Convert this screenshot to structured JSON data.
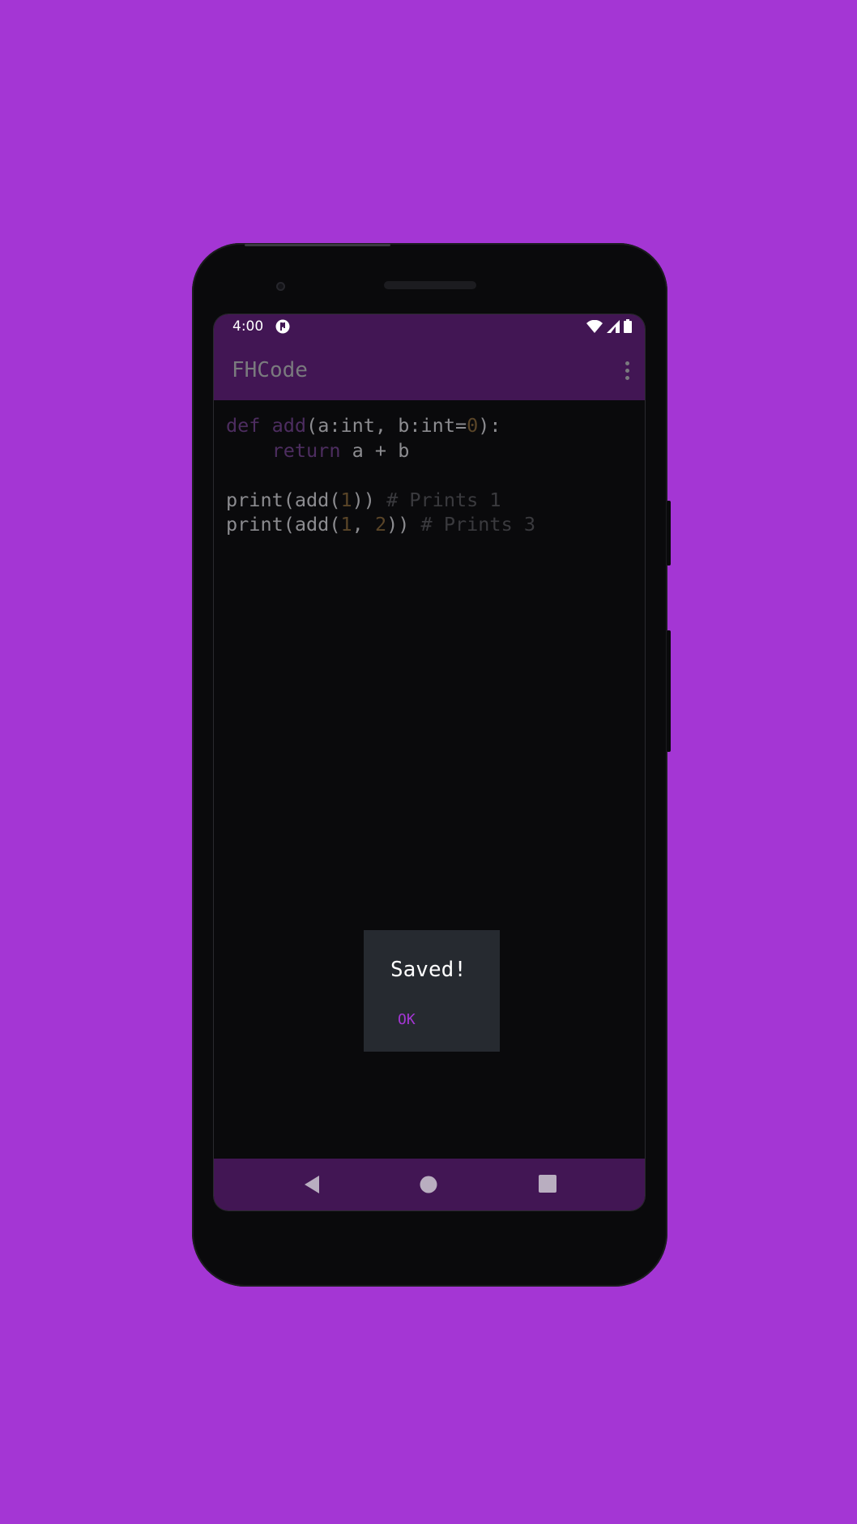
{
  "status_bar": {
    "time": "4:00"
  },
  "app_bar": {
    "title": "FHCode",
    "menu_icon": "more-vert-icon"
  },
  "editor": {
    "lines": [
      [
        {
          "t": "def ",
          "c": "kw"
        },
        {
          "t": "add",
          "c": "fn"
        },
        {
          "t": "(a:int, b:int=",
          "c": "plain"
        },
        {
          "t": "0",
          "c": "num"
        },
        {
          "t": "):",
          "c": "plain"
        }
      ],
      [
        {
          "t": "    ",
          "c": "plain"
        },
        {
          "t": "return",
          "c": "kw"
        },
        {
          "t": " a + b",
          "c": "plain"
        }
      ],
      [],
      [
        {
          "t": "print(add(",
          "c": "plain"
        },
        {
          "t": "1",
          "c": "num"
        },
        {
          "t": ")) ",
          "c": "plain"
        },
        {
          "t": "# Prints 1",
          "c": "comment"
        }
      ],
      [
        {
          "t": "print(add(",
          "c": "plain"
        },
        {
          "t": "1",
          "c": "num"
        },
        {
          "t": ", ",
          "c": "plain"
        },
        {
          "t": "2",
          "c": "num"
        },
        {
          "t": ")) ",
          "c": "plain"
        },
        {
          "t": "# Prints 3",
          "c": "comment"
        }
      ]
    ]
  },
  "dialog": {
    "title": "Saved!",
    "ok_label": "OK"
  },
  "navigation": {
    "back_icon": "back-icon",
    "home_icon": "home-icon",
    "recents_icon": "recents-icon"
  },
  "colors": {
    "background": "#a436d4",
    "bar": "#421654",
    "accent": "#a436d4",
    "dialog": "#262a30"
  }
}
